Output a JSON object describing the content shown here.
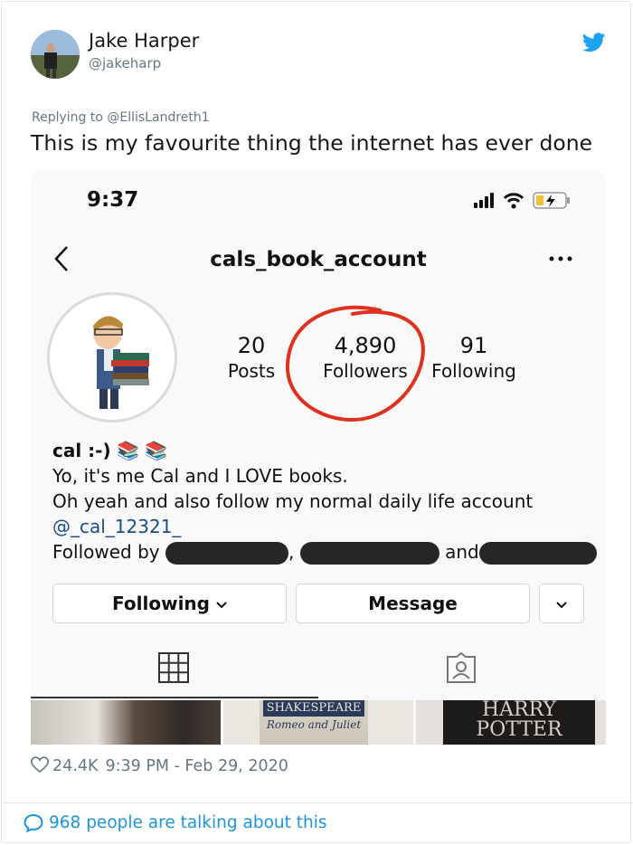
{
  "tweet": {
    "author_name": "Jake Harper",
    "author_handle": "@jakeharp",
    "replying_to": "Replying to @EllisLandreth1",
    "text": "This is my favourite thing the internet has ever done",
    "likes": "24.4K",
    "timestamp": "9:39 PM - Feb 29, 2020",
    "talking": "968 people are talking about this",
    "brand_color": "#1da1f2"
  },
  "embedded": {
    "status_time": "9:37",
    "username": "cals_book_account",
    "stats": [
      {
        "num": "20",
        "label": "Posts"
      },
      {
        "num": "4,890",
        "label": "Followers"
      },
      {
        "num": "91",
        "label": "Following"
      }
    ],
    "bio": {
      "name": "cal :-)",
      "emoji": "📚 📚",
      "line1": "Yo, it's me Cal and I LOVE books.",
      "line2": "Oh yeah and also follow my normal daily life account",
      "mention": "@_cal_12321_",
      "followed_by": "Followed by",
      "comma": ",",
      "and": "and"
    },
    "buttons": {
      "following": "Following",
      "message": "Message"
    },
    "thumbs": {
      "shakespeare": "SHAKESPEARE",
      "romeo": "Romeo and Juliet",
      "harry": "HARRY",
      "potter": "POTTER"
    },
    "annotation_color": "#e0301e"
  },
  "icons": [
    "twitter-bird-icon",
    "back-chevron-icon",
    "more-dots-icon",
    "grid-icon",
    "tagged-icon",
    "heart-icon",
    "speech-bubble-icon"
  ]
}
